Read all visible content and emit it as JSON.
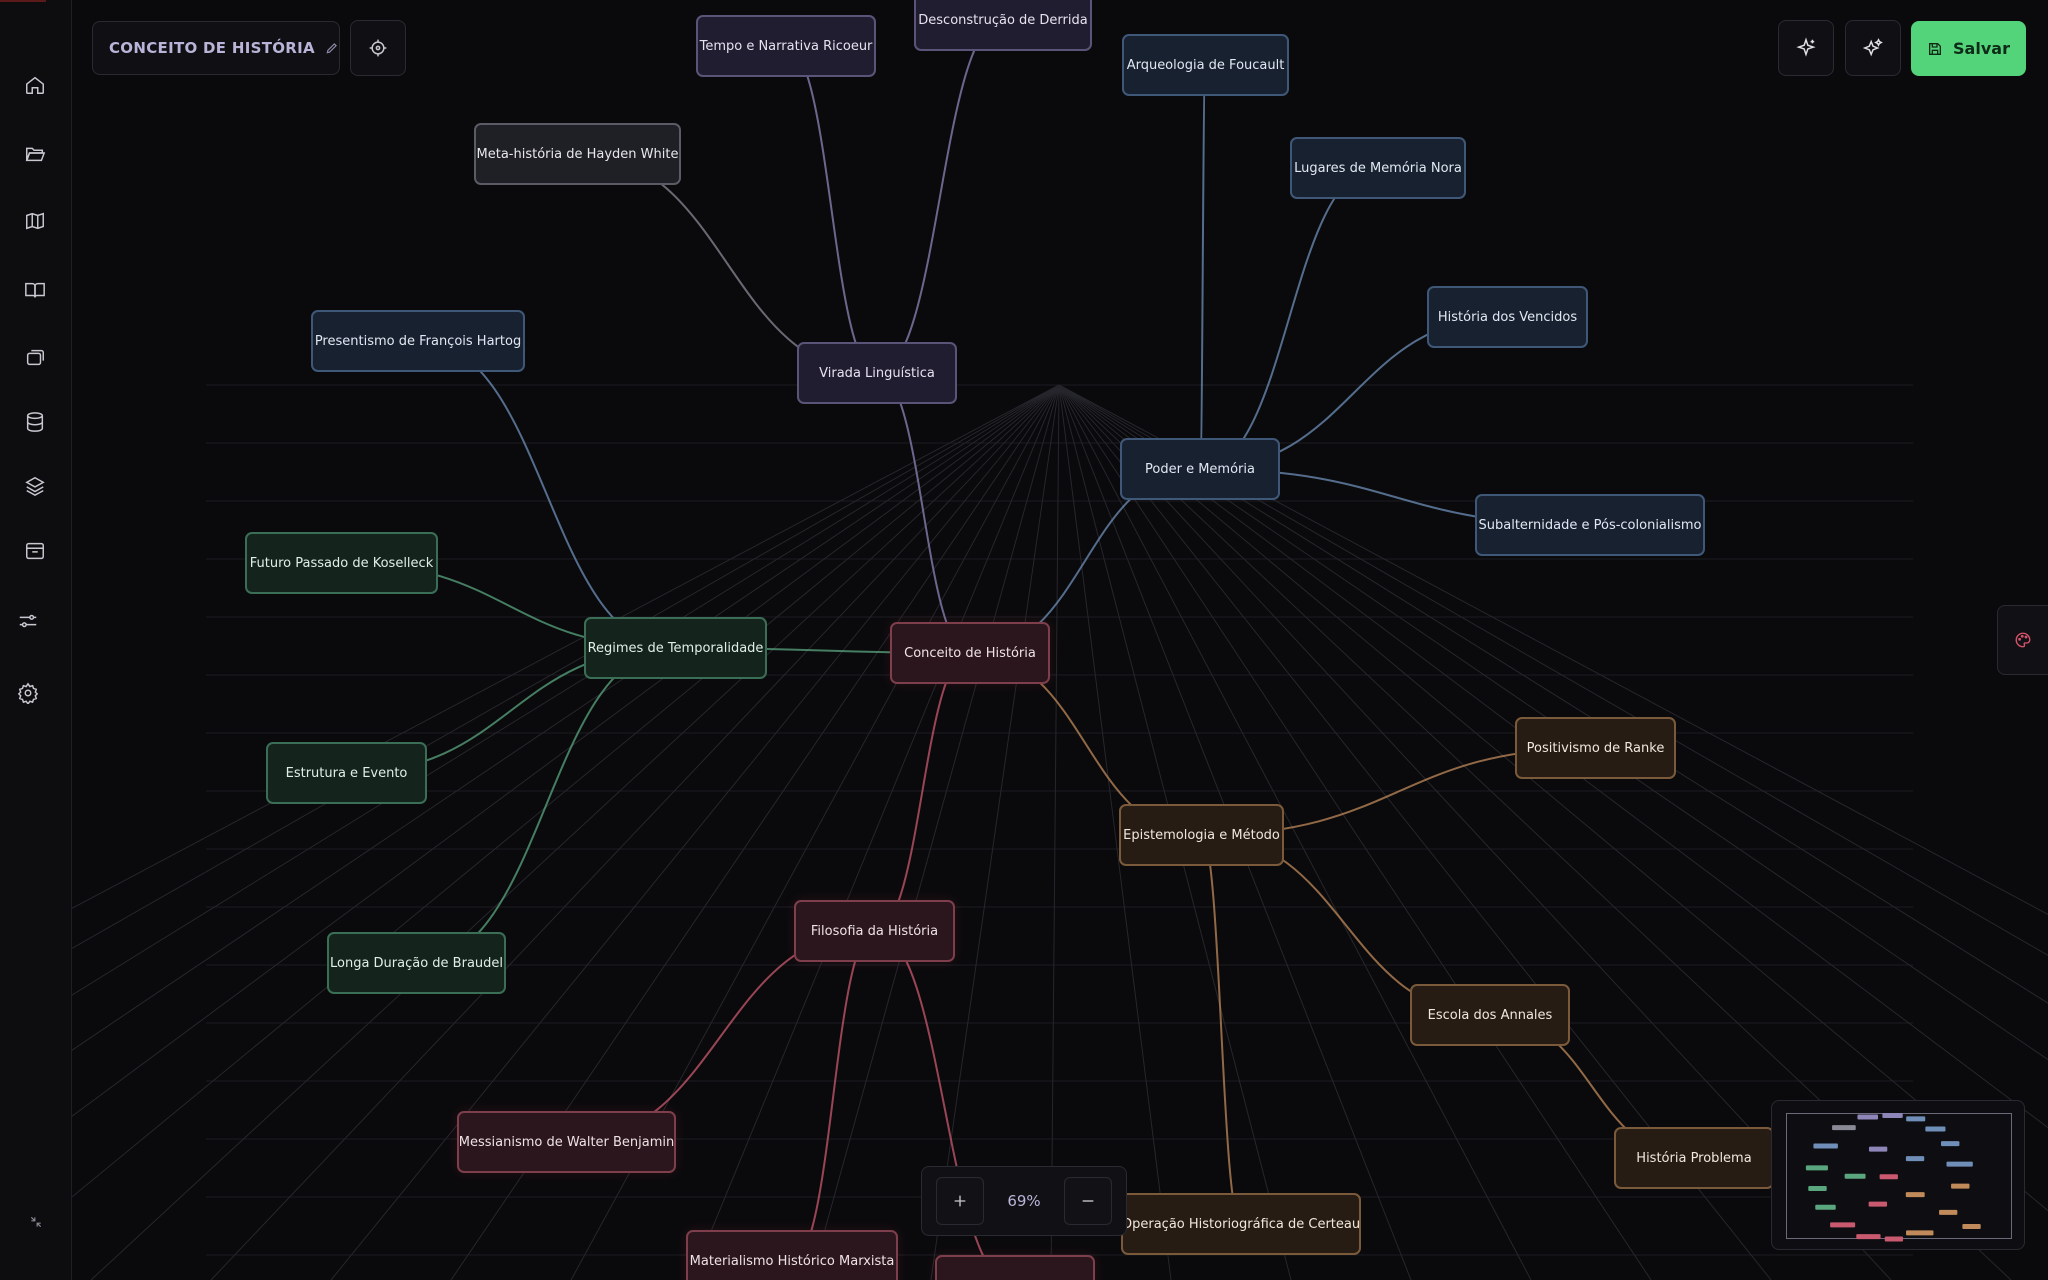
{
  "document": {
    "title": "CONCEITO DE HISTÓRIA"
  },
  "toolbar": {
    "save_label": "Salvar"
  },
  "zoom": {
    "level": "69%"
  },
  "colors": {
    "accent_save": "#54d47a",
    "red": "#c9596f",
    "purple": "#8e86b8",
    "gray": "#8a8a96",
    "blue": "#6f8fb8",
    "green": "#5aa67f",
    "brown": "#c08a5a"
  },
  "sidebar": {
    "items": [
      {
        "icon": "home-icon"
      },
      {
        "icon": "folder-open-icon"
      },
      {
        "icon": "map-icon"
      },
      {
        "icon": "book-open-icon"
      },
      {
        "icon": "copy-icon"
      },
      {
        "icon": "database-icon"
      },
      {
        "icon": "layers-icon"
      },
      {
        "icon": "archive-icon"
      },
      {
        "icon": "sliders-icon"
      },
      {
        "icon": "gear-icon"
      }
    ]
  },
  "nodes": [
    {
      "id": "central",
      "label": "Conceito de História",
      "color": "red"
    },
    {
      "id": "virada",
      "label": "Virada Linguística",
      "color": "purple"
    },
    {
      "id": "tempo",
      "label": "Tempo e Narrativa Ricoeur",
      "color": "purple"
    },
    {
      "id": "derrida",
      "label": "Desconstrução de Derrida",
      "color": "purple"
    },
    {
      "id": "white",
      "label": "Meta-história de Hayden White",
      "color": "gray"
    },
    {
      "id": "poder",
      "label": "Poder e Memória",
      "color": "blue"
    },
    {
      "id": "foucault",
      "label": "Arqueologia de Foucault",
      "color": "blue"
    },
    {
      "id": "nora",
      "label": "Lugares de Memória Nora",
      "color": "blue"
    },
    {
      "id": "vencidos",
      "label": "História dos Vencidos",
      "color": "blue"
    },
    {
      "id": "subalt",
      "label": "Subalternidade e Pós-colonialismo",
      "color": "blue"
    },
    {
      "id": "regimes",
      "label": "Regimes de Temporalidade",
      "color": "green"
    },
    {
      "id": "hartog",
      "label": "Presentismo de François Hartog",
      "color": "blue"
    },
    {
      "id": "koselleck",
      "label": "Futuro Passado de Koselleck",
      "color": "green"
    },
    {
      "id": "estrutura",
      "label": "Estrutura e Evento",
      "color": "green"
    },
    {
      "id": "braudel",
      "label": "Longa Duração de Braudel",
      "color": "green"
    },
    {
      "id": "episteme",
      "label": "Epistemologia e Método",
      "color": "brown"
    },
    {
      "id": "ranke",
      "label": "Positivismo de Ranke",
      "color": "brown"
    },
    {
      "id": "annales",
      "label": "Escola dos Annales",
      "color": "brown"
    },
    {
      "id": "problema",
      "label": "História Problema",
      "color": "brown"
    },
    {
      "id": "certeau",
      "label": "Operação Historiográfica de Certeau",
      "color": "brown"
    },
    {
      "id": "filosofia",
      "label": "Filosofia da História",
      "color": "red"
    },
    {
      "id": "benjamin",
      "label": "Messianismo de Walter Benjamin",
      "color": "red"
    },
    {
      "id": "marxista",
      "label": "Materialismo Histórico Marxista",
      "color": "red"
    },
    {
      "id": "hidden",
      "label": "",
      "color": "red"
    }
  ],
  "edges": [
    [
      "central",
      "virada"
    ],
    [
      "central",
      "poder"
    ],
    [
      "central",
      "regimes"
    ],
    [
      "central",
      "episteme"
    ],
    [
      "central",
      "filosofia"
    ],
    [
      "virada",
      "tempo"
    ],
    [
      "virada",
      "derrida"
    ],
    [
      "virada",
      "white"
    ],
    [
      "poder",
      "foucault"
    ],
    [
      "poder",
      "nora"
    ],
    [
      "poder",
      "vencidos"
    ],
    [
      "poder",
      "subalt"
    ],
    [
      "regimes",
      "hartog"
    ],
    [
      "regimes",
      "koselleck"
    ],
    [
      "regimes",
      "estrutura"
    ],
    [
      "regimes",
      "braudel"
    ],
    [
      "episteme",
      "ranke"
    ],
    [
      "episteme",
      "annales"
    ],
    [
      "episteme",
      "certeau"
    ],
    [
      "annales",
      "problema"
    ],
    [
      "filosofia",
      "benjamin"
    ],
    [
      "filosofia",
      "marxista"
    ],
    [
      "filosofia",
      "hidden"
    ]
  ]
}
